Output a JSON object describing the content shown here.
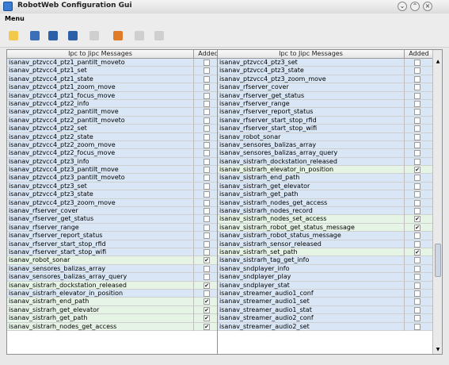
{
  "window": {
    "title": "RobotWeb Configuration Gui",
    "controls": [
      "chevron-down-icon",
      "chevron-up-icon",
      "close-icon"
    ]
  },
  "menubar": {
    "menu_label": "Menu"
  },
  "toolbar": {
    "buttons": [
      {
        "name": "new-icon",
        "enabled": true,
        "color": "#f2c94c"
      },
      {
        "name": "open-icon",
        "enabled": true,
        "color": "#3b6fb8"
      },
      {
        "name": "save-icon",
        "enabled": true,
        "color": "#2b5fa8"
      },
      {
        "name": "save-as-icon",
        "enabled": true,
        "color": "#2b5fa8"
      },
      {
        "name": "stop-icon",
        "enabled": false,
        "color": "#b8b8b8"
      },
      {
        "name": "settings-icon",
        "enabled": true,
        "color": "#e07b2a"
      },
      {
        "name": "tools-icon",
        "enabled": false,
        "color": "#b8b8b8"
      },
      {
        "name": "window-icon",
        "enabled": false,
        "color": "#b8b8b8"
      }
    ]
  },
  "left_table": {
    "headers": [
      "Ipc to Jipc Messages",
      "Added"
    ],
    "rows": [
      {
        "message": "isanav_ptzvcc4_ptz1_pantilt_moveto",
        "added": false,
        "highlight": "blue"
      },
      {
        "message": "isanav_ptzvcc4_ptz1_set",
        "added": false,
        "highlight": "blue"
      },
      {
        "message": "isanav_ptzvcc4_ptz1_state",
        "added": false,
        "highlight": "blue"
      },
      {
        "message": "isanav_ptzvcc4_ptz1_zoom_move",
        "added": false,
        "highlight": "blue"
      },
      {
        "message": "isanav_ptzvcc4_ptz1_focus_move",
        "added": false,
        "highlight": "blue"
      },
      {
        "message": "isanav_ptzvcc4_ptz2_info",
        "added": false,
        "highlight": "blue"
      },
      {
        "message": "isanav_ptzvcc4_ptz2_pantilt_move",
        "added": false,
        "highlight": "blue"
      },
      {
        "message": "isanav_ptzvcc4_ptz2_pantilt_moveto",
        "added": false,
        "highlight": "blue"
      },
      {
        "message": "isanav_ptzvcc4_ptz2_set",
        "added": false,
        "highlight": "blue"
      },
      {
        "message": "isanav_ptzvcc4_ptz2_state",
        "added": false,
        "highlight": "blue"
      },
      {
        "message": "isanav_ptzvcc4_ptz2_zoom_move",
        "added": false,
        "highlight": "blue"
      },
      {
        "message": "isanav_ptzvcc4_ptz2_focus_move",
        "added": false,
        "highlight": "blue"
      },
      {
        "message": "isanav_ptzvcc4_ptz3_info",
        "added": false,
        "highlight": "blue"
      },
      {
        "message": "isanav_ptzvcc4_ptz3_pantilt_move",
        "added": false,
        "highlight": "blue"
      },
      {
        "message": "isanav_ptzvcc4_ptz3_pantilt_moveto",
        "added": false,
        "highlight": "blue"
      },
      {
        "message": "isanav_ptzvcc4_ptz3_set",
        "added": false,
        "highlight": "blue"
      },
      {
        "message": "isanav_ptzvcc4_ptz3_state",
        "added": false,
        "highlight": "blue"
      },
      {
        "message": "isanav_ptzvcc4_ptz3_zoom_move",
        "added": false,
        "highlight": "blue"
      },
      {
        "message": "isanav_rfserver_cover",
        "added": false,
        "highlight": "blue"
      },
      {
        "message": "isanav_rfserver_get_status",
        "added": false,
        "highlight": "blue"
      },
      {
        "message": "isanav_rfserver_range",
        "added": false,
        "highlight": "blue"
      },
      {
        "message": "isanav_rfserver_report_status",
        "added": false,
        "highlight": "blue"
      },
      {
        "message": "isanav_rfserver_start_stop_rfid",
        "added": false,
        "highlight": "blue"
      },
      {
        "message": "isanav_rfserver_start_stop_wifi",
        "added": false,
        "highlight": "blue"
      },
      {
        "message": "isanav_robot_sonar",
        "added": true,
        "highlight": "green"
      },
      {
        "message": "isanav_sensores_balizas_array",
        "added": false,
        "highlight": "blue"
      },
      {
        "message": "isanav_sensores_balizas_array_query",
        "added": false,
        "highlight": "blue"
      },
      {
        "message": "isanav_sistrarh_dockstation_released",
        "added": true,
        "highlight": "green"
      },
      {
        "message": "isanav_sistrarh_elevator_in_position",
        "added": false,
        "highlight": "blue"
      },
      {
        "message": "isanav_sistrarh_end_path",
        "added": true,
        "highlight": "green"
      },
      {
        "message": "isanav_sistrarh_get_elevator",
        "added": true,
        "highlight": "green"
      },
      {
        "message": "isanav_sistrarh_get_path",
        "added": true,
        "highlight": "green"
      },
      {
        "message": "isanav_sistrarh_nodes_get_access",
        "added": true,
        "highlight": "green"
      }
    ]
  },
  "right_table": {
    "headers": [
      "Ipc to Jipc Messages",
      "Added"
    ],
    "rows": [
      {
        "message": "isanav_ptzvcc4_ptz3_set",
        "added": false,
        "highlight": "blue"
      },
      {
        "message": "isanav_ptzvcc4_ptz3_state",
        "added": false,
        "highlight": "blue"
      },
      {
        "message": "isanav_ptzvcc4_ptz3_zoom_move",
        "added": false,
        "highlight": "blue"
      },
      {
        "message": "isanav_rfserver_cover",
        "added": false,
        "highlight": "blue"
      },
      {
        "message": "isanav_rfserver_get_status",
        "added": false,
        "highlight": "blue"
      },
      {
        "message": "isanav_rfserver_range",
        "added": false,
        "highlight": "blue"
      },
      {
        "message": "isanav_rfserver_report_status",
        "added": false,
        "highlight": "blue"
      },
      {
        "message": "isanav_rfserver_start_stop_rfid",
        "added": false,
        "highlight": "blue"
      },
      {
        "message": "isanav_rfserver_start_stop_wifi",
        "added": false,
        "highlight": "blue"
      },
      {
        "message": "isanav_robot_sonar",
        "added": false,
        "highlight": "blue"
      },
      {
        "message": "isanav_sensores_balizas_array",
        "added": false,
        "highlight": "blue"
      },
      {
        "message": "isanav_sensores_balizas_array_query",
        "added": false,
        "highlight": "blue"
      },
      {
        "message": "isanav_sistrarh_dockstation_released",
        "added": false,
        "highlight": "blue"
      },
      {
        "message": "isanav_sistrarh_elevator_in_position",
        "added": true,
        "highlight": "green"
      },
      {
        "message": "isanav_sistrarh_end_path",
        "added": false,
        "highlight": "blue"
      },
      {
        "message": "isanav_sistrarh_get_elevator",
        "added": false,
        "highlight": "blue"
      },
      {
        "message": "isanav_sistrarh_get_path",
        "added": false,
        "highlight": "blue"
      },
      {
        "message": "isanav_sistrarh_nodes_get_access",
        "added": false,
        "highlight": "blue"
      },
      {
        "message": "isanav_sistrarh_nodes_record",
        "added": false,
        "highlight": "blue"
      },
      {
        "message": "isanav_sistrarh_nodes_set_access",
        "added": true,
        "highlight": "green"
      },
      {
        "message": "isanav_sistrarh_robot_get_status_message",
        "added": true,
        "highlight": "green"
      },
      {
        "message": "isanav_sistrarh_robot_status_message",
        "added": false,
        "highlight": "blue"
      },
      {
        "message": "isanav_sistrarh_sensor_released",
        "added": false,
        "highlight": "blue"
      },
      {
        "message": "isanav_sistrarh_set_path",
        "added": true,
        "highlight": "green"
      },
      {
        "message": "isanav_sistrarh_tag_get_info",
        "added": false,
        "highlight": "blue"
      },
      {
        "message": "isanav_sndplayer_info",
        "added": false,
        "highlight": "blue"
      },
      {
        "message": "isanav_sndplayer_play",
        "added": false,
        "highlight": "blue"
      },
      {
        "message": "isanav_sndplayer_stat",
        "added": false,
        "highlight": "blue"
      },
      {
        "message": "isanav_streamer_audio1_conf",
        "added": false,
        "highlight": "blue"
      },
      {
        "message": "isanav_streamer_audio1_set",
        "added": false,
        "highlight": "blue"
      },
      {
        "message": "isanav_streamer_audio1_stat",
        "added": false,
        "highlight": "blue"
      },
      {
        "message": "isanav_streamer_audio2_conf",
        "added": false,
        "highlight": "blue"
      },
      {
        "message": "isanav_streamer_audio2_set",
        "added": false,
        "highlight": "blue"
      }
    ]
  },
  "scrollbars": {
    "left": {
      "position_fraction": 0.58,
      "visible_fraction": 0.09
    },
    "right": {
      "position_fraction": 0.72,
      "visible_fraction": 0.12
    }
  },
  "colors": {
    "blue_row": "#d9e6f5",
    "green_row": "#e6f4e6",
    "check": "✔",
    "up_arrow": "▲",
    "down_arrow": "▼"
  }
}
